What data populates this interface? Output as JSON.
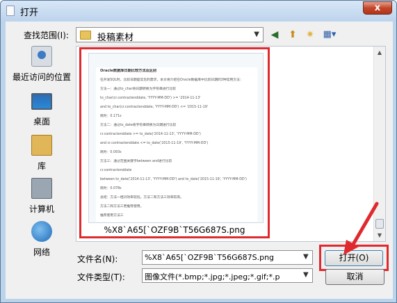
{
  "window": {
    "title": "打开",
    "close_glyph": "x"
  },
  "toolbar": {
    "look_in_label": "查找范围(I):",
    "look_in_value": "投稿素材",
    "back_glyph": "◀",
    "up_glyph": "⬆",
    "new_folder_glyph": "✷",
    "view_glyph": "▦▾"
  },
  "places": [
    {
      "label": "最近访问的位置",
      "icon": "recent-places-icon"
    },
    {
      "label": "桌面",
      "icon": "desktop-icon"
    },
    {
      "label": "库",
      "icon": "library-icon"
    },
    {
      "label": "计算机",
      "icon": "computer-icon"
    },
    {
      "label": "网络",
      "icon": "network-icon"
    }
  ],
  "file": {
    "name": "%X8`A65[`OZF9B`T56G687S.png",
    "preview_lines": [
      "Oracle数据库日期比较方法及区别",
      "在开发SQL时，比较日期是常见的需求，本文将介绍在Oracle数据库中比较日期的3种常用方法：",
      "方法一：通过to_char将日期转换为字符串进行比较",
      "to_char(cr.contractenddate, 'YYYY-MM-DD') >= '2014-11-13'",
      "and to_char(cr.contractenddate, 'YYYY-MM-DD') <= '2015-11-19'",
      "耗时：0.171s",
      "方法二：通过to_date将字符串转换为日期进行比较",
      "cr.contractenddate >= to_date('2014-11-13', 'YYYY-MM-DD')",
      "and cr.contractenddate <= to_date('2015-11-19', 'YYYY-MM-DD')",
      "耗时：0.093s",
      "方法三：通过范围关键字between and进行比较",
      "cr.contractenddate",
      "between to_date('2014-11-13', 'YYYY-MM-DD') and to_date('2015-11-19', 'YYYY-MM-DD')",
      "耗时：0.078s",
      "总结：方法一相对效率较低，方法二和方法三效率较高。",
      "方法二和方法三更推荐使用。",
      "推荐使用方法三"
    ]
  },
  "form": {
    "filename_label": "文件名(N):",
    "filename_value": "%X8`A65[`OZF9B`T56G687S.png",
    "filetype_label": "文件类型(T):",
    "filetype_value": "图像文件(*.bmp;*.jpg;*.jpeg;*.gif;*.p",
    "open_label": "打开(O)",
    "cancel_label": "取消",
    "dropdown_glyph": "▼"
  },
  "colors": {
    "highlight": "#e0292e",
    "accent": "#3c7fb1"
  }
}
